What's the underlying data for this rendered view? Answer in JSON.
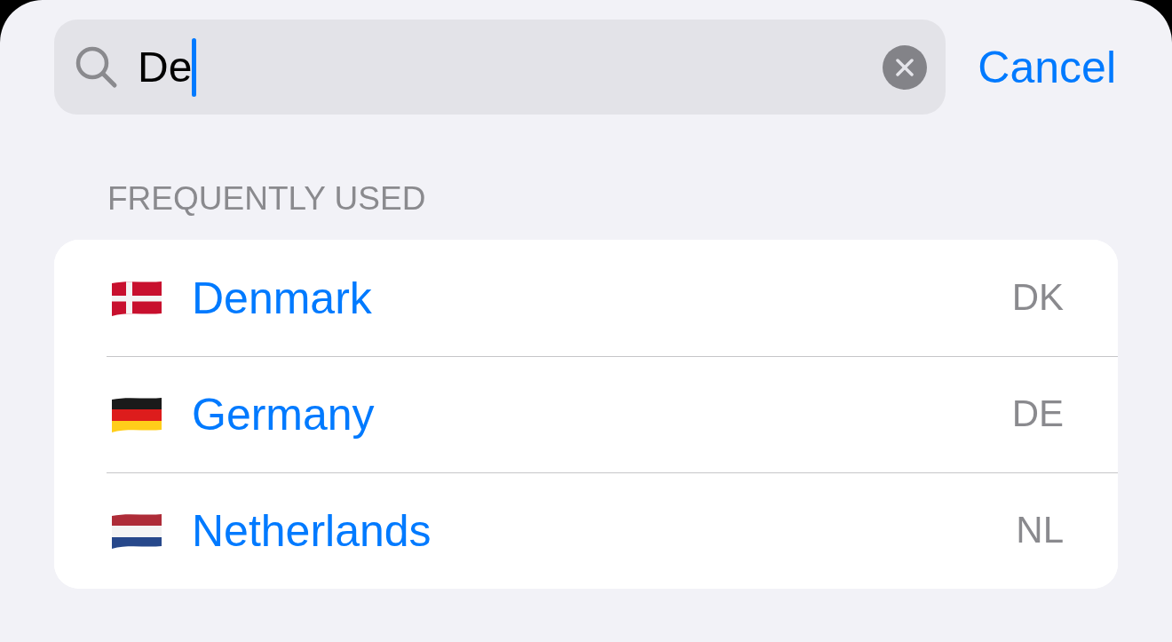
{
  "search": {
    "value": "De",
    "focused": true
  },
  "cancel_button": {
    "label": "Cancel"
  },
  "section": {
    "title": "FREQUENTLY USED",
    "items": [
      {
        "kind": "danish",
        "name": "Denmark",
        "code": "DK"
      },
      {
        "kind": "german",
        "name": "Germany",
        "code": "DE"
      },
      {
        "kind": "dutch",
        "name": "Netherlands",
        "code": "NL"
      }
    ]
  }
}
